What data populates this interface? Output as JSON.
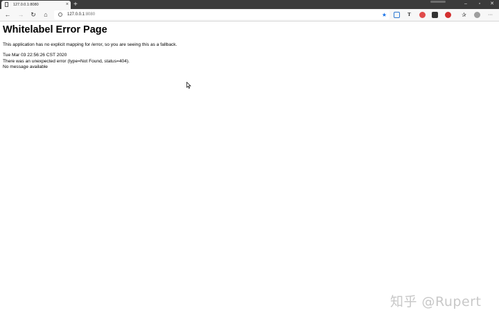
{
  "browser": {
    "tab": {
      "title": "127.0.0.1:8080",
      "close_glyph": "×",
      "favicon": "page-icon"
    },
    "new_tab_glyph": "+",
    "window_controls": {
      "minimize": "–",
      "maximize": "▫",
      "close": "✕"
    },
    "toolbar": {
      "back_glyph": "←",
      "forward_glyph": "→",
      "reload_glyph": "↻",
      "home_glyph": "⌂",
      "address": {
        "host": "127.0.0.1",
        "port": ":8080",
        "info_icon": "info-icon",
        "star_glyph": "★"
      },
      "extensions": {
        "translate_glyph": "T",
        "favorites_glyph": "✰",
        "more_glyph": "···"
      }
    }
  },
  "page": {
    "title": "Whitelabel Error Page",
    "fallback_message": "This application has no explicit mapping for /error, so you are seeing this as a fallback.",
    "timestamp": "Tue Mar 03 22:56:26 CST 2020",
    "error_detail": "There was an unexpected error (type=Not Found, status=404).",
    "no_message": "No message available"
  },
  "watermark": {
    "text": "知乎 @Rupert"
  },
  "colors": {
    "titlebar": "#3b3b3b",
    "toolbar": "#f7f7f7",
    "star": "#1a73e8",
    "watermark": "#c8c8c8"
  }
}
